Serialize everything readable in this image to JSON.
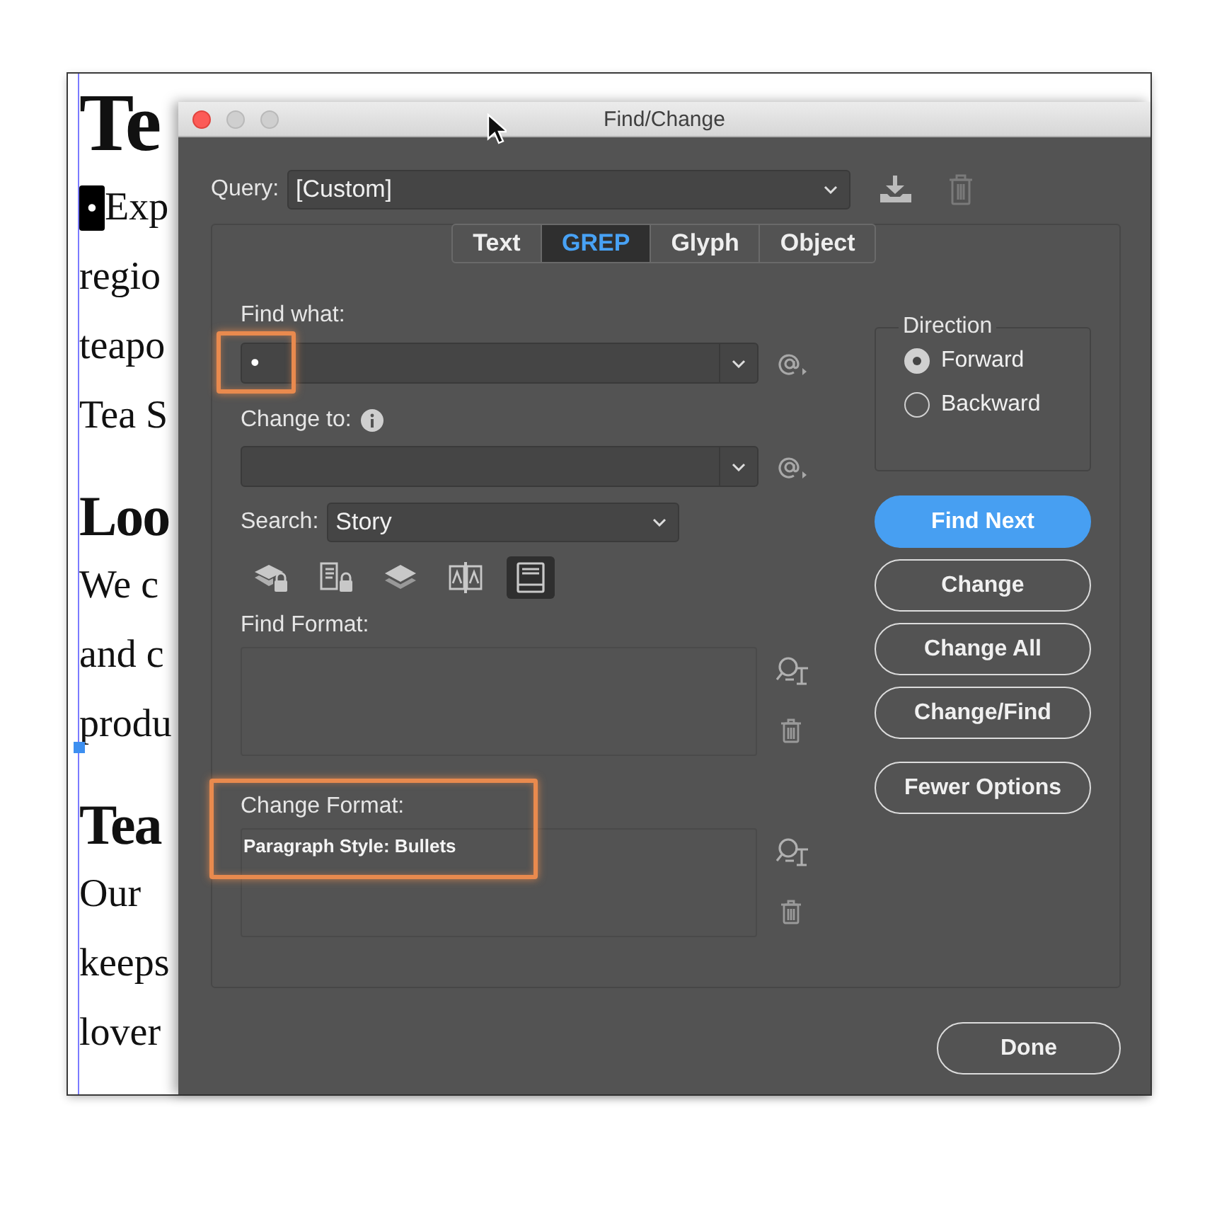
{
  "document": {
    "lines": [
      {
        "kind": "title",
        "text": "Te"
      },
      {
        "kind": "bullet",
        "marker": "•",
        "selected": true,
        "text": "Exp"
      },
      {
        "kind": "body",
        "text": "regio"
      },
      {
        "kind": "body",
        "text": "teapo"
      },
      {
        "kind": "body",
        "text": "Tea S"
      },
      {
        "kind": "heading",
        "text": "Loo"
      },
      {
        "kind": "body",
        "text": "We c"
      },
      {
        "kind": "body",
        "text": "and c"
      },
      {
        "kind": "body",
        "text": "produ"
      },
      {
        "kind": "heading",
        "text": "Tea"
      },
      {
        "kind": "body",
        "text": "Our"
      },
      {
        "kind": "body",
        "text": "keeps"
      },
      {
        "kind": "body",
        "text": "lover"
      }
    ]
  },
  "dialog": {
    "title": "Find/Change",
    "query": {
      "label": "Query:",
      "value": "[Custom]"
    },
    "tabs": [
      {
        "label": "Text",
        "selected": false
      },
      {
        "label": "GREP",
        "selected": true
      },
      {
        "label": "Glyph",
        "selected": false
      },
      {
        "label": "Object",
        "selected": false
      }
    ],
    "find_what": {
      "label": "Find what:",
      "value": "•",
      "highlighted": true
    },
    "change_to": {
      "label": "Change to:"
    },
    "search": {
      "label": "Search:",
      "value": "Story"
    },
    "search_options": [
      {
        "kind": "locked-layers",
        "selected": false
      },
      {
        "kind": "locked-stories",
        "selected": false
      },
      {
        "kind": "hidden-layers",
        "selected": false
      },
      {
        "kind": "master-pages",
        "selected": false
      },
      {
        "kind": "footnotes",
        "selected": true
      }
    ],
    "find_format": {
      "label": "Find Format:"
    },
    "change_format": {
      "label": "Change Format:",
      "value": "Paragraph Style: Bullets",
      "highlighted": true
    },
    "direction": {
      "label": "Direction",
      "options": [
        {
          "label": "Forward",
          "selected": true
        },
        {
          "label": "Backward",
          "selected": false
        }
      ]
    },
    "buttons": [
      {
        "label": "Find Next",
        "kind": "primary"
      },
      {
        "label": "Change",
        "kind": "normal"
      },
      {
        "label": "Change All",
        "kind": "normal"
      },
      {
        "label": "Change/Find",
        "kind": "normal"
      },
      {
        "label": "Fewer Options",
        "kind": "toggle"
      }
    ],
    "done": {
      "label": "Done"
    }
  }
}
